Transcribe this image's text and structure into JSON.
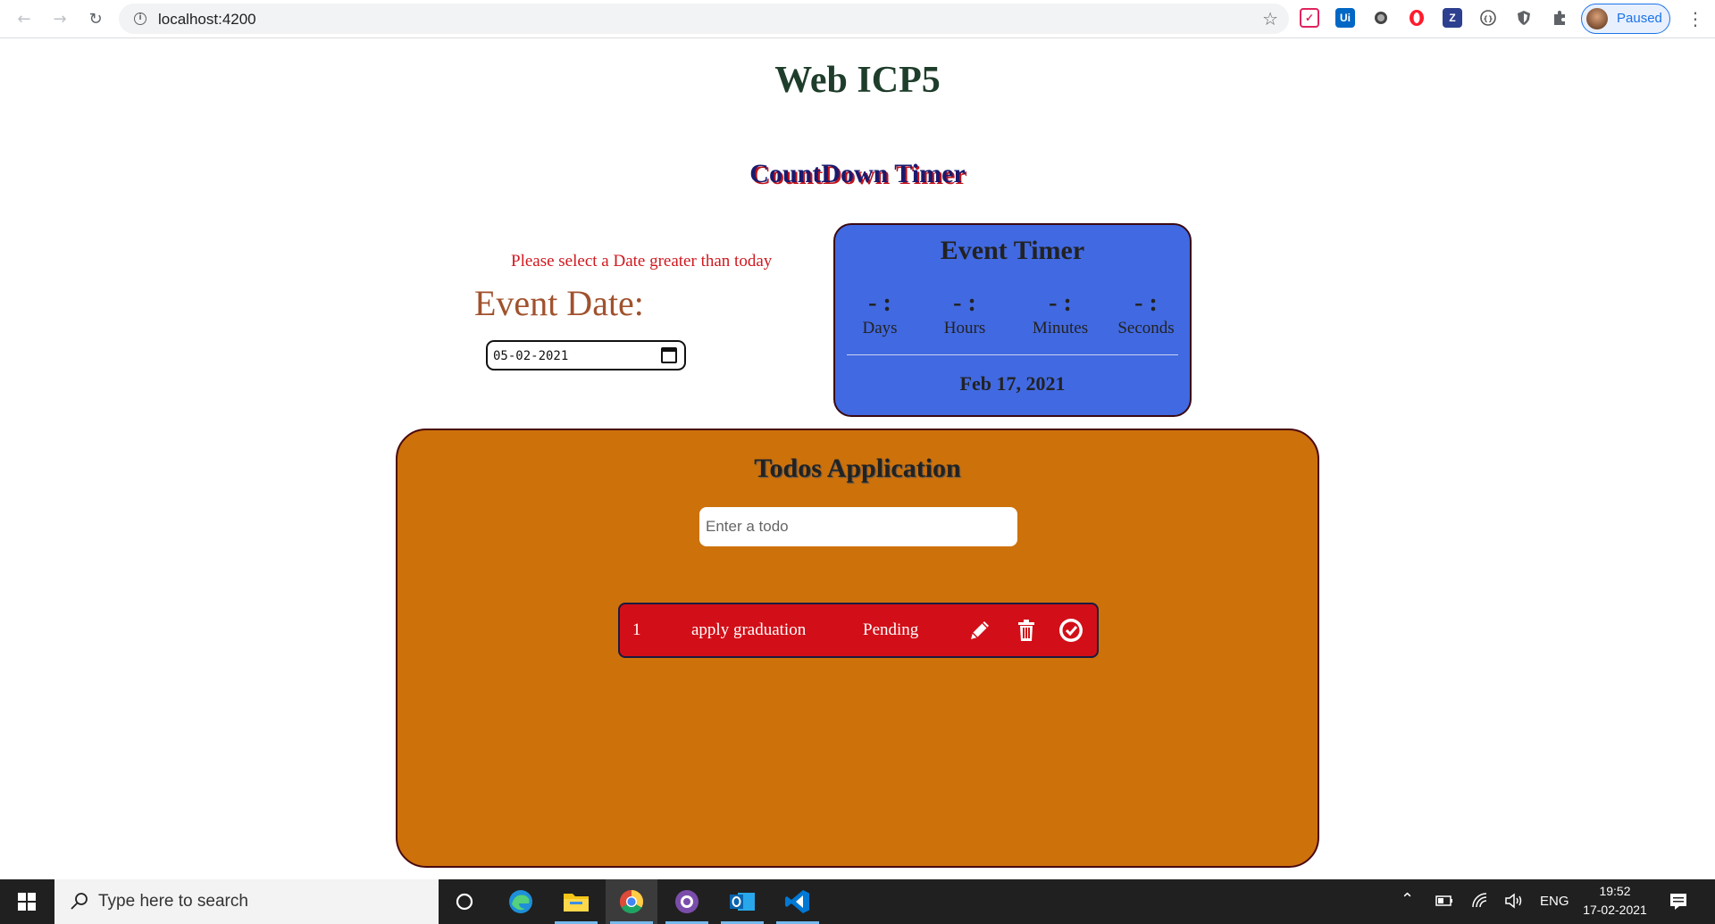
{
  "browser": {
    "url": "localhost:4200",
    "profile_label": "Paused",
    "extensions": [
      "pocket-icon",
      "uipath-icon",
      "circle-extension-icon",
      "opera-icon",
      "zotero-icon",
      "code-extension-icon",
      "shield-extension-icon",
      "puzzle-icon"
    ]
  },
  "page": {
    "title": "Web ICP5",
    "countdown_heading": "CountDown Timer",
    "warning": "Please select a Date greater than today",
    "event_date_label": "Event Date:",
    "event_date_value": "05-02-2021"
  },
  "timer": {
    "title": "Event Timer",
    "units": [
      {
        "value": "- :",
        "label": "Days"
      },
      {
        "value": "- :",
        "label": "Hours"
      },
      {
        "value": "- :",
        "label": "Minutes"
      },
      {
        "value": "- :",
        "label": "Seconds"
      }
    ],
    "date": "Feb 17, 2021"
  },
  "todos": {
    "title": "Todos Application",
    "input_placeholder": "Enter a todo",
    "items": [
      {
        "index": "1",
        "text": "apply graduation",
        "status": "Pending"
      }
    ]
  },
  "taskbar": {
    "search_placeholder": "Type here to search",
    "language": "ENG",
    "time": "19:52",
    "date": "17-02-2021"
  },
  "colors": {
    "timer_bg": "#4169e1",
    "todos_bg": "#cd710b",
    "todo_row_bg": "#d20f18",
    "warning": "#d0181f",
    "event_label": "#a0522d"
  }
}
